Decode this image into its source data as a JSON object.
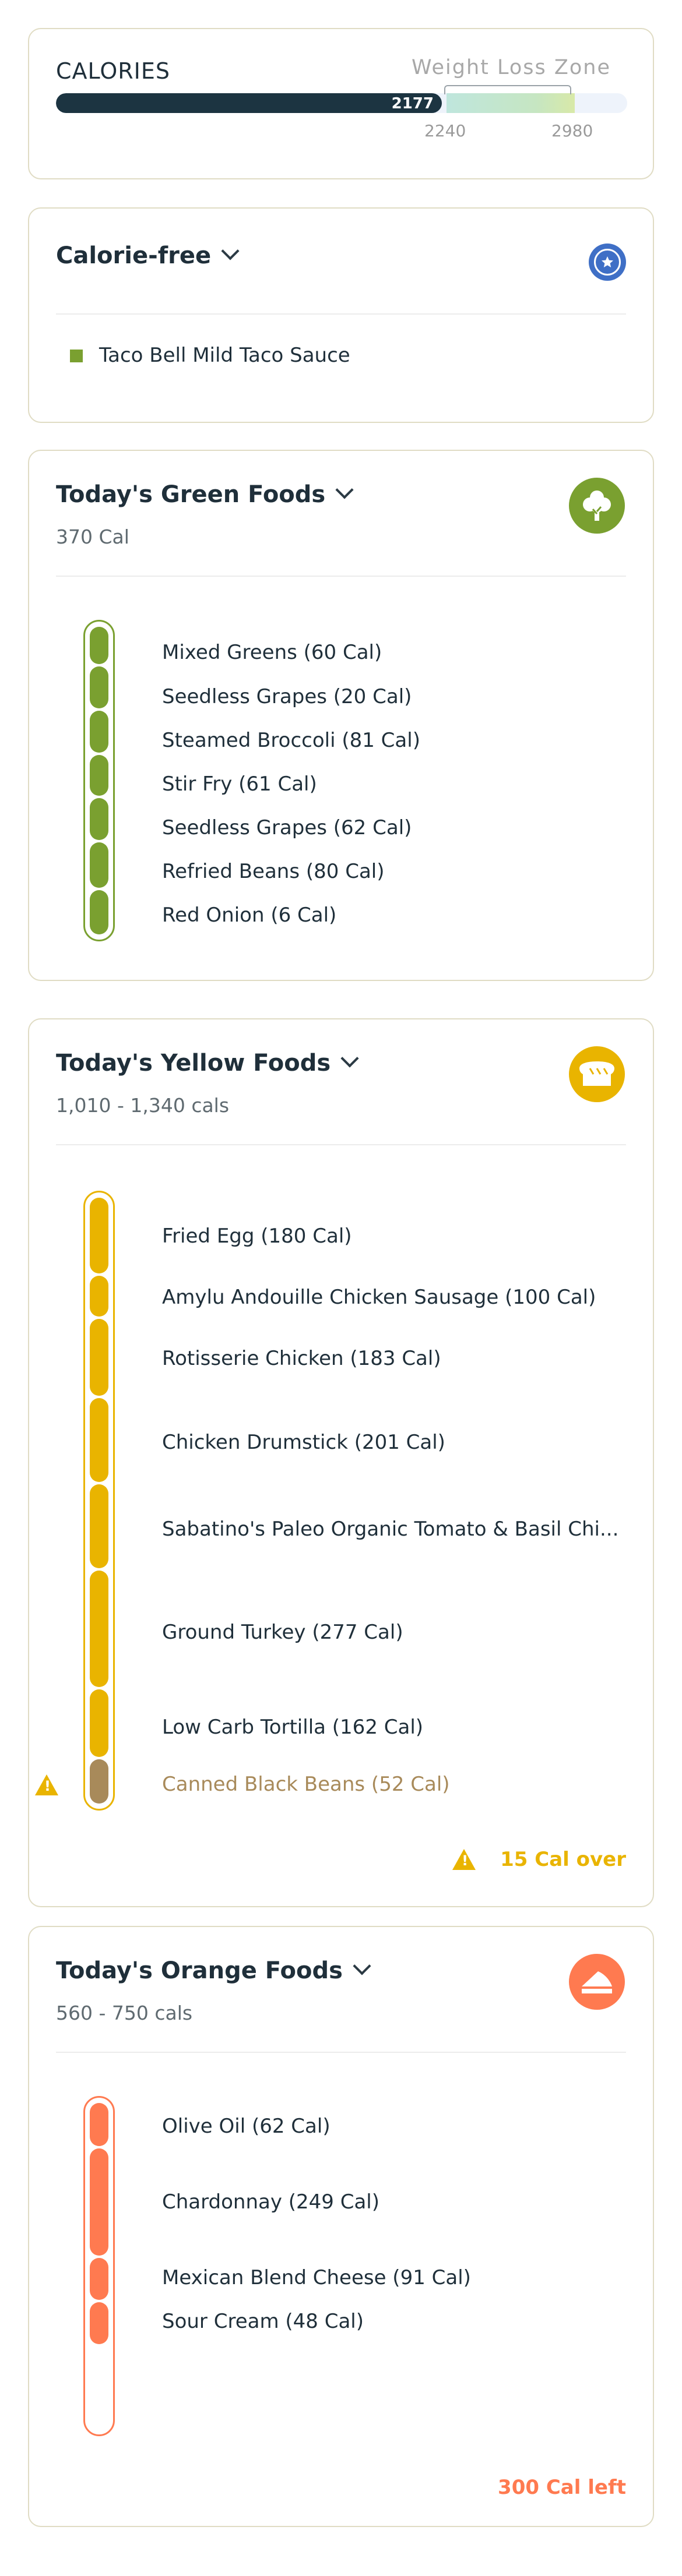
{
  "calories": {
    "label": "CALORIES",
    "zone_label": "Weight Loss Zone",
    "consumed": "2177",
    "zone_low": "2240",
    "zone_high": "2980",
    "progress_fraction": 0.676
  },
  "calorie_free": {
    "title": "Calorie-free",
    "items": [
      "Taco Bell Mild Taco Sauce"
    ]
  },
  "green": {
    "title": "Today's Green Foods",
    "subtitle": "370 Cal",
    "color": "#7aa030",
    "icon": "tree-icon",
    "items": [
      "Mixed Greens (60 Cal)",
      "Seedless Grapes (20 Cal)",
      "Steamed Broccoli (81 Cal)",
      "Stir Fry (61 Cal)",
      "Seedless Grapes (62 Cal)",
      "Refried Beans (80 Cal)",
      "Red Onion (6 Cal)"
    ]
  },
  "yellow": {
    "title": "Today's Yellow Foods",
    "subtitle": "1,010 - 1,340 cals",
    "color": "#e9b400",
    "over_color": "#a88a5a",
    "icon": "bread-icon",
    "items": [
      "Fried Egg (180 Cal)",
      "Amylu Andouille Chicken Sausage (100 Cal)",
      "Rotisserie Chicken (183 Cal)",
      "Chicken Drumstick (201 Cal)",
      "Sabatino's Paleo Organic Tomato & Basil Chi...",
      "Ground Turkey (277 Cal)",
      "Low Carb Tortilla (162 Cal)",
      "Canned Black Beans (52 Cal)"
    ],
    "status": "15 Cal over"
  },
  "orange": {
    "title": "Today's Orange Foods",
    "subtitle": "560 - 750 cals",
    "color": "#ff7a50",
    "icon": "cake-slice-icon",
    "items": [
      "Olive Oil (62 Cal)",
      "Chardonnay (249 Cal)",
      "Mexican Blend Cheese (91 Cal)",
      "Sour Cream (48 Cal)"
    ],
    "status": "300 Cal left"
  }
}
